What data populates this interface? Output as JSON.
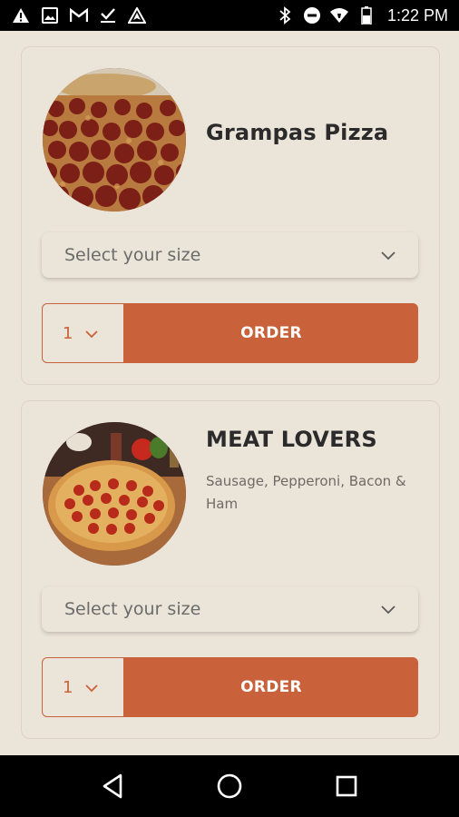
{
  "status_bar": {
    "time": "1:22 PM",
    "left_icons": [
      "warning-icon",
      "image-icon",
      "gmail-icon",
      "task-check-icon",
      "nav-arrow-icon"
    ],
    "right_icons": [
      "bluetooth-icon",
      "do-not-disturb-icon",
      "wifi-icon",
      "battery-icon"
    ]
  },
  "products": [
    {
      "name": "Grampas Pizza",
      "description": "",
      "size_placeholder": "Select your size",
      "quantity": "1",
      "order_label": "ORDER"
    },
    {
      "name": "MEAT LOVERS",
      "description": "Sausage, Pepperoni, Bacon & Ham",
      "size_placeholder": "Select your size",
      "quantity": "1",
      "order_label": "ORDER"
    }
  ],
  "colors": {
    "background": "#ebe4d9",
    "accent": "#c9623a",
    "title": "#2b2b2b",
    "muted": "#6f6a65"
  },
  "nav_bar": {
    "icons": [
      "back-icon",
      "home-icon",
      "recents-icon"
    ]
  }
}
